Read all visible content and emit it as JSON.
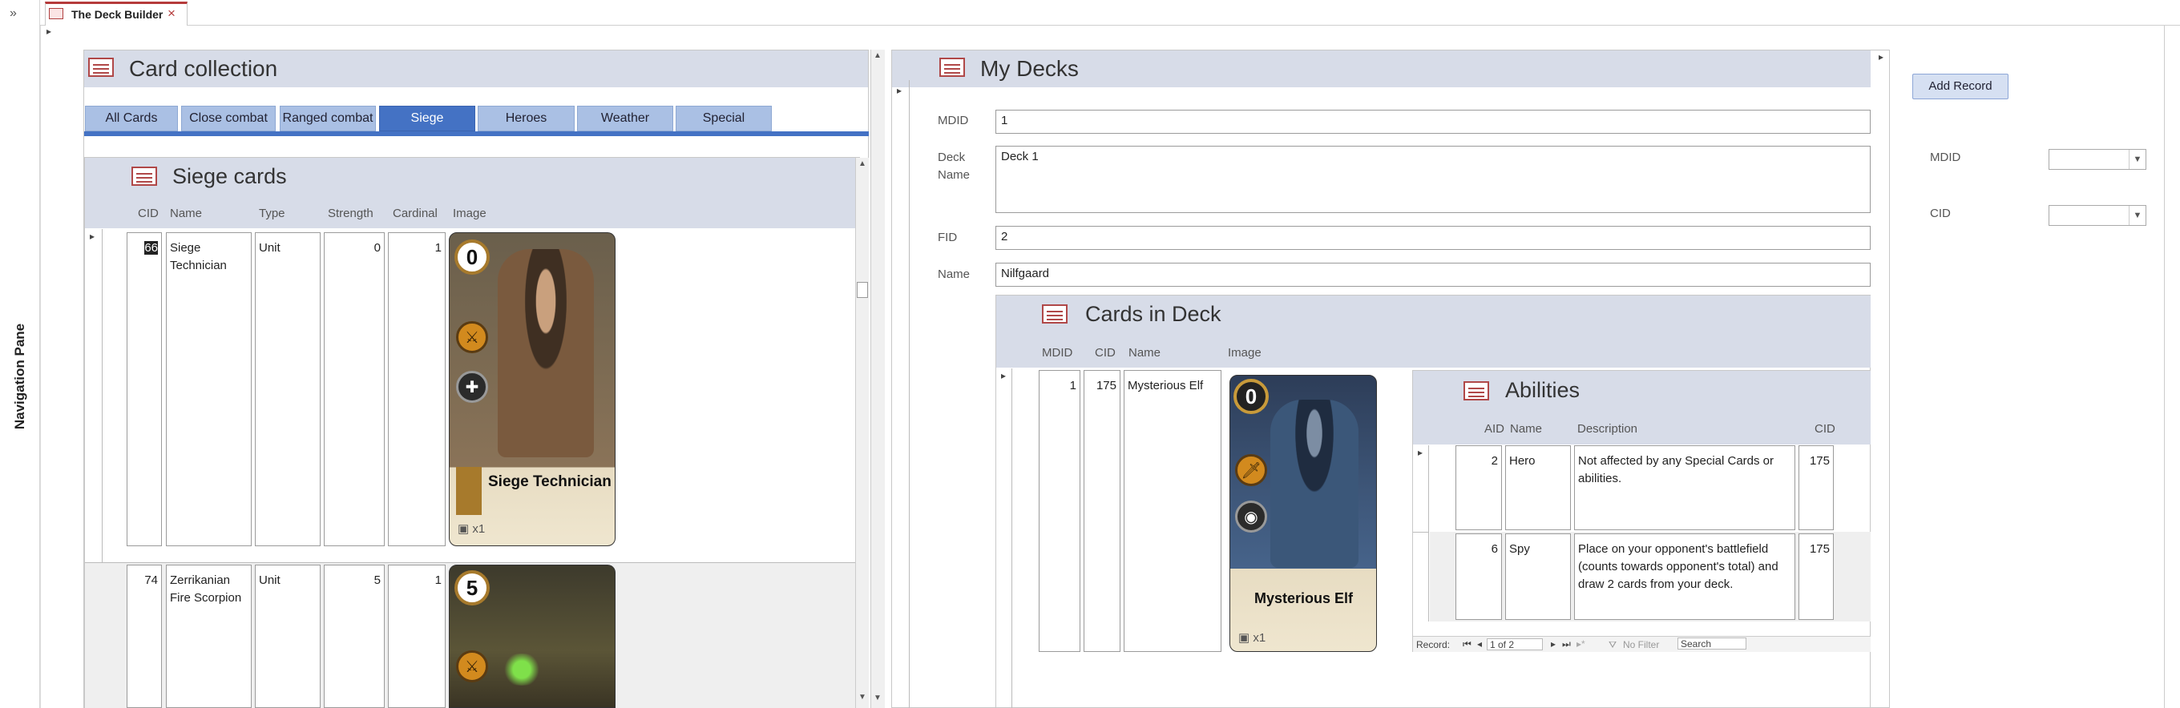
{
  "nav": {
    "pane_label": "Navigation Pane",
    "toggle": "»"
  },
  "doc_tab": {
    "title": "The Deck Builder",
    "close": "×"
  },
  "collection": {
    "title": "Card collection",
    "tabs": [
      "All Cards",
      "Close combat",
      "Ranged combat",
      "Siege",
      "Heroes",
      "Weather",
      "Special"
    ],
    "active_tab": "Siege",
    "subform_title": "Siege cards",
    "columns": [
      "CID",
      "Name",
      "Type",
      "Strength",
      "Cardinal",
      "Image"
    ],
    "rows": [
      {
        "cid": "66",
        "name": "Siege Technician",
        "type": "Unit",
        "strength": "0",
        "cardinal": "1",
        "card_strength": "0",
        "card_name": "Siege Technician",
        "card_count": "x1"
      },
      {
        "cid": "74",
        "name": "Zerrikanian Fire Scorpion",
        "type": "Unit",
        "strength": "5",
        "cardinal": "1",
        "card_strength": "5"
      }
    ]
  },
  "decks": {
    "title": "My Decks",
    "fields": {
      "mdid_label": "MDID",
      "mdid": "1",
      "deck_name_label": "Deck Name",
      "deck_name": "Deck 1",
      "fid_label": "FID",
      "fid": "2",
      "name_label": "Name",
      "name": "Nilfgaard"
    },
    "cards_in_deck": {
      "title": "Cards in Deck",
      "columns": [
        "MDID",
        "CID",
        "Name",
        "Image"
      ],
      "row": {
        "mdid": "1",
        "cid": "175",
        "name": "Mysterious Elf",
        "card_strength": "0",
        "card_name": "Mysterious Elf",
        "card_count": "x1"
      }
    },
    "abilities": {
      "title": "Abilities",
      "columns": [
        "AID",
        "Name",
        "Description",
        "CID"
      ],
      "rows": [
        {
          "aid": "2",
          "name": "Hero",
          "description": "Not affected by any Special Cards or abilities.",
          "cid": "175"
        },
        {
          "aid": "6",
          "name": "Spy",
          "description": "Place on your opponent's battlefield (counts towards opponent's total) and draw 2 cards from your deck.",
          "cid": "175"
        }
      ],
      "nav": {
        "record_label": "Record:",
        "position": "1 of 2",
        "no_filter": "No Filter",
        "search": "Search"
      }
    }
  },
  "side": {
    "add_record": "Add Record",
    "mdid_label": "MDID",
    "cid_label": "CID"
  },
  "colors": {
    "active_tab": "#4472c4",
    "tab": "#aac0e4",
    "header_band": "#d7dce8",
    "doc_tab_accent": "#b53b3b"
  }
}
